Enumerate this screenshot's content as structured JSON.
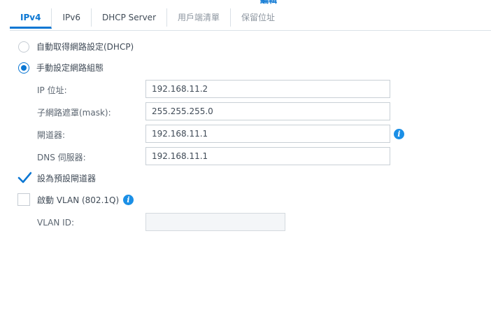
{
  "window_title_fragment": "編輯",
  "tabs": [
    {
      "label": "IPv4"
    },
    {
      "label": "IPv6"
    },
    {
      "label": "DHCP Server"
    },
    {
      "label": "用戶端清單"
    },
    {
      "label": "保留位址"
    }
  ],
  "options": {
    "dhcp_label": "自動取得網路設定(DHCP)",
    "manual_label": "手動設定網路組態",
    "selected": "manual"
  },
  "fields": {
    "ip": {
      "label": "IP 位址:",
      "value": "192.168.11.2"
    },
    "mask": {
      "label": "子網路遮罩(mask):",
      "value": "255.255.255.0"
    },
    "gateway": {
      "label": "閘道器:",
      "value": "192.168.11.1"
    },
    "dns": {
      "label": "DNS 伺服器:",
      "value": "192.168.11.1"
    }
  },
  "default_gateway": {
    "label": "設為預設閘道器",
    "checked": true
  },
  "vlan": {
    "label": "啟動 VLAN (802.1Q)",
    "checked": false,
    "id_label": "VLAN ID:",
    "id_value": ""
  },
  "colors": {
    "accent": "#0b77d3",
    "info": "#1b8fe6"
  },
  "icons": {
    "info": "info-icon"
  }
}
